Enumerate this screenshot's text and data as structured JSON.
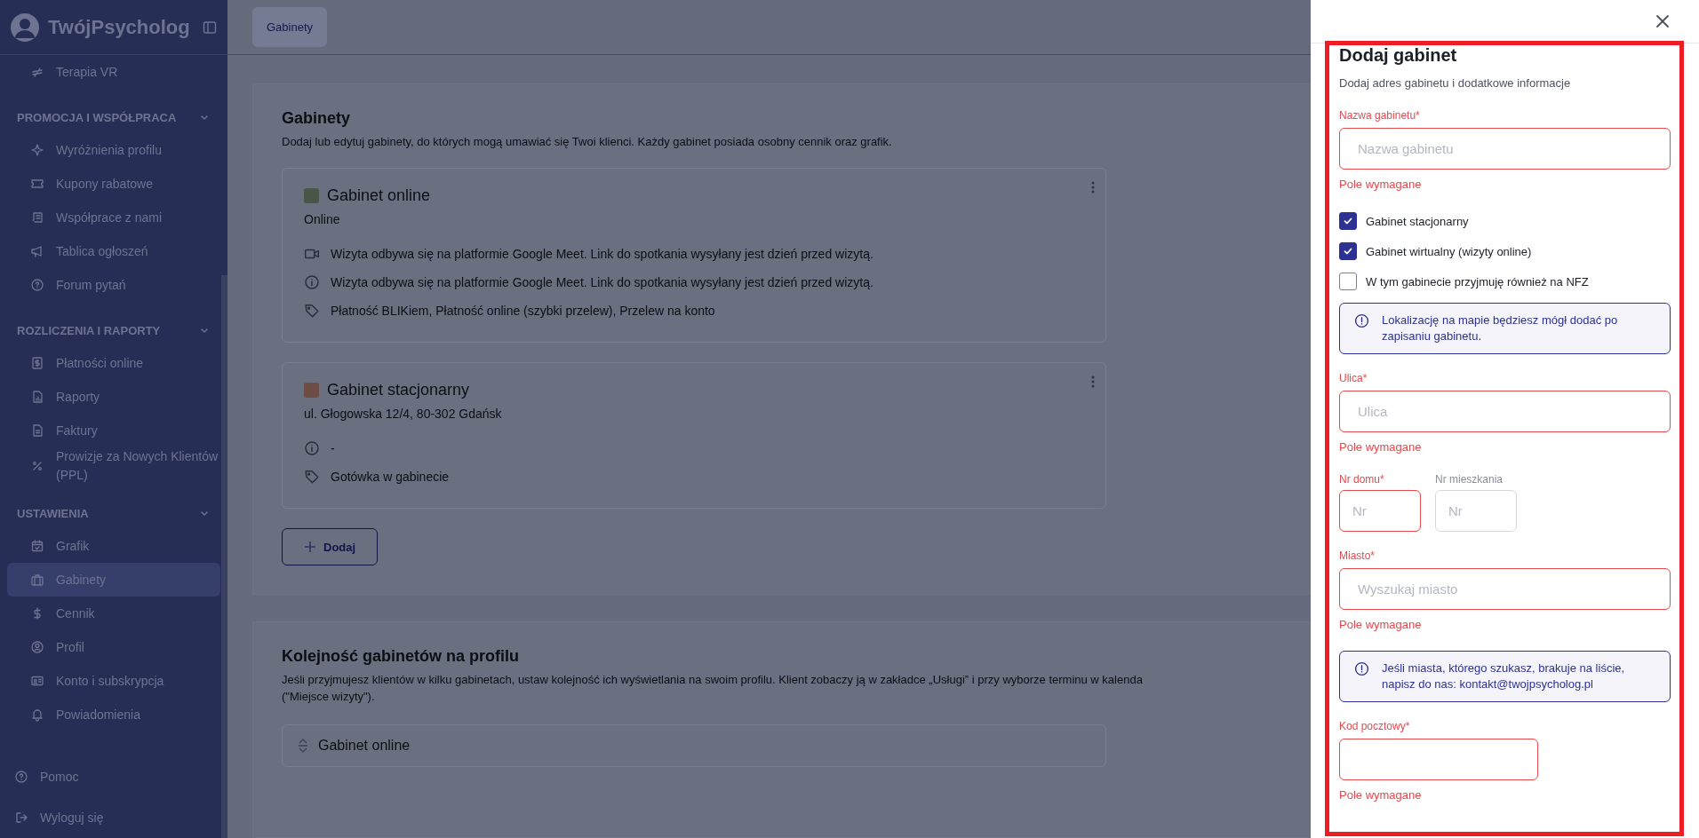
{
  "sidebar": {
    "brand": "TwójPsycholog",
    "top_items": [
      {
        "label": "Terapia VR",
        "selected": false
      }
    ],
    "sections": [
      {
        "title": "PROMOCJA I WSPÓŁPRACA",
        "expanded": true,
        "items": [
          {
            "label": "Wyróżnienia profilu",
            "selected": false
          },
          {
            "label": "Kupony rabatowe",
            "selected": false
          },
          {
            "label": "Współprace z nami",
            "selected": false
          },
          {
            "label": "Tablica ogłoszeń",
            "selected": false
          },
          {
            "label": "Forum pytań",
            "selected": false
          }
        ]
      },
      {
        "title": "ROZLICZENIA I RAPORTY",
        "expanded": true,
        "items": [
          {
            "label": "Płatności online",
            "selected": false
          },
          {
            "label": "Raporty",
            "selected": false
          },
          {
            "label": "Faktury",
            "selected": false
          },
          {
            "label": "Prowizje za Nowych Klientów (PPL)",
            "selected": false
          }
        ]
      },
      {
        "title": "USTAWIENIA",
        "expanded": true,
        "items": [
          {
            "label": "Grafik",
            "selected": false
          },
          {
            "label": "Gabinety",
            "selected": true
          },
          {
            "label": "Cennik",
            "selected": false
          },
          {
            "label": "Profil",
            "selected": false
          },
          {
            "label": "Konto i subskrypcja",
            "selected": false
          },
          {
            "label": "Powiadomienia",
            "selected": false
          }
        ]
      }
    ],
    "footer": [
      {
        "label": "Pomoc"
      },
      {
        "label": "Wyloguj się"
      }
    ]
  },
  "topbar": {
    "tab": "Gabinety"
  },
  "offices": {
    "title": "Gabinety",
    "description": "Dodaj lub edytuj gabinety, do których mogą umawiać się Twoi klienci. Każdy gabinet posiada osobny cennik oraz grafik.",
    "cards": [
      {
        "name": "Gabinet online",
        "color": "#48564a",
        "subtitle": "Online",
        "details": [
          "Wizyta odbywa się na platformie Google Meet. Link do spotkania wysyłany jest dzień przed wizytą.",
          "Wizyta odbywa się na platformie Google Meet. Link do spotkania wysyłany jest dzień przed wizytą.",
          "Płatność BLIKiem,  Płatność online (szybki przelew),  Przelew na konto"
        ]
      },
      {
        "name": "Gabinet stacjonarny",
        "color": "#6e4e44",
        "subtitle": "ul. Głogowska 12/4, 80-302 Gdańsk",
        "details": [
          "-",
          "Gotówka w gabinecie"
        ]
      }
    ],
    "add_button": "Dodaj"
  },
  "order": {
    "title": "Kolejność gabinetów na profilu",
    "description": "Jeśli przyjmujesz klientów w kilku gabinetach, ustaw kolejność ich wyświetlania na swoim profilu. Klient zobaczy ją w zakładce „Usługi” i przy wyborze terminu w kalenda",
    "description_2": "(\"Miejsce wizyty\").",
    "items": [
      "Gabinet online"
    ]
  },
  "drawer": {
    "title": "Dodaj gabinet",
    "subtitle": "Dodaj adres gabinetu i dodatkowe informacje",
    "fields": [
      {
        "kind": "input",
        "label": "Nazwa gabinetu*",
        "placeholder": "Nazwa gabinetu",
        "error": "Pole wymagane",
        "invalid": true
      },
      {
        "kind": "checkbox",
        "label": "Gabinet stacjonarny",
        "checked": true
      },
      {
        "kind": "checkbox",
        "label": "Gabinet wirtualny (wizyty online)",
        "checked": true
      },
      {
        "kind": "checkbox",
        "label": "W tym gabinecie przyjmuję również na NFZ",
        "checked": false
      },
      {
        "kind": "info",
        "text": "Lokalizację na mapie będziesz mógł dodać po zapisaniu gabinetu."
      },
      {
        "kind": "input",
        "label": "Ulica*",
        "placeholder": "Ulica",
        "error": "Pole wymagane",
        "invalid": true
      },
      {
        "kind": "pair",
        "items": [
          {
            "label": "Nr domu*",
            "placeholder": "Nr",
            "invalid": true
          },
          {
            "label": "Nr mieszkania",
            "placeholder": "Nr",
            "invalid": false
          }
        ]
      },
      {
        "kind": "input",
        "label": "Miasto*",
        "placeholder": "Wyszukaj miasto",
        "error": "Pole wymagane",
        "invalid": true
      },
      {
        "kind": "info",
        "text": "Jeśli miasta, którego szukasz, brakuje na liście, napisz do nas: kontakt@twojpsycholog.pl"
      },
      {
        "kind": "short-input",
        "label": "Kod pocztowy*",
        "error": "Pole wymagane",
        "invalid": true
      }
    ]
  }
}
